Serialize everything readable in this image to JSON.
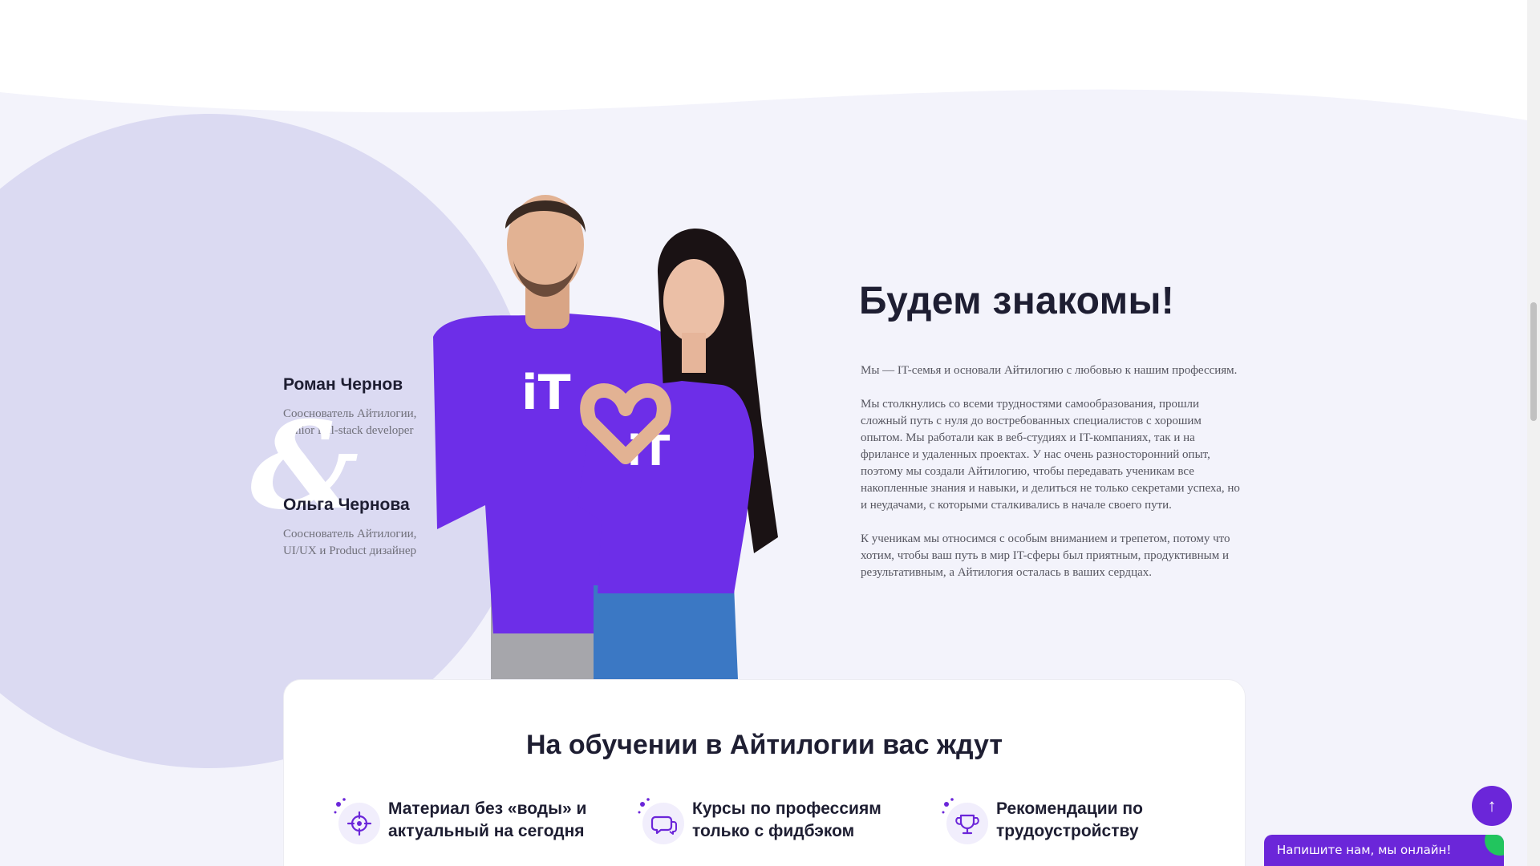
{
  "colors": {
    "accent": "#6b26d9",
    "section_bg": "#f3f3fb",
    "circle": "#dbdaf2",
    "heading": "#1e1e32",
    "muted": "#70707a"
  },
  "founders": [
    {
      "name": "Роман Чернов",
      "role_lines": [
        "Сооснователь Айтилогии,",
        "Senior full-stack developer"
      ]
    },
    {
      "name": "Ольга Чернова",
      "role_lines": [
        "Сооснователь Айтилогии,",
        "UI/UX и Product дизайнер"
      ]
    }
  ],
  "ampersand": "&",
  "photo": {
    "shirt_logo_left": "iT",
    "shirt_logo_right": "iT"
  },
  "intro": {
    "title": "Будем знакомы!",
    "paragraphs": [
      "Мы — IT-семья и основали Айтилогию с любовью к нашим профессиям.",
      "Мы столкнулись со всеми трудностями самообразования, прошли сложный путь с нуля до востребованных специалистов с хорошим опытом. Мы работали как в веб-студиях и IT-компаниях, так и на фрилансе и удаленных проектах. У нас очень разносторонний опыт, поэтому мы создали Айтилогию, чтобы передавать ученикам все накопленные знания и навыки, и делиться не только секретами успеха, но и неудачами, с которыми сталкивались в начале своего пути.",
      "К ученикам мы относимся с особым вниманием и трепетом, потому что хотим, чтобы ваш путь в мир IT-сферы был приятным, продуктивным и результативным, а Айтилогия осталась в ваших сердцах."
    ]
  },
  "benefits": {
    "title": "На обучении в Айтилогии вас ждут",
    "items": [
      {
        "icon": "target-icon",
        "lines": [
          "Материал без «воды» и",
          "актуальный на сегодня"
        ]
      },
      {
        "icon": "chat-bubbles-icon",
        "lines": [
          "Курсы по профессиям",
          "только с фидбэком"
        ]
      },
      {
        "icon": "trophy-icon",
        "lines": [
          "Рекомендации по",
          "трудоустройству"
        ]
      }
    ]
  },
  "scroll_top": {
    "icon": "arrow-up-icon",
    "glyph": "↑"
  },
  "chat": {
    "label": "Напишите нам, мы онлайн!"
  }
}
